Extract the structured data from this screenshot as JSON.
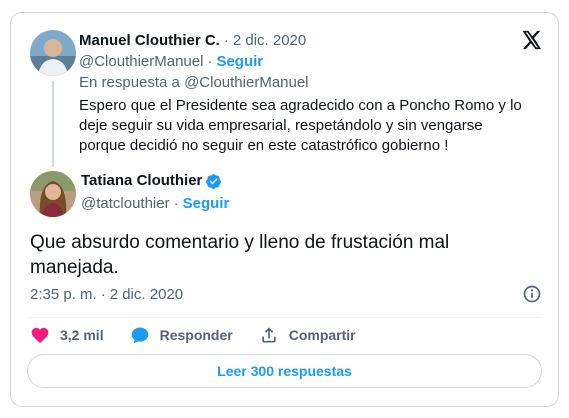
{
  "colors": {
    "accent": "#1d9bf0",
    "like": "#f91880",
    "muted": "#536471",
    "text": "#0f1419",
    "border": "#cfd9de"
  },
  "parent_tweet": {
    "author_name": "Manuel Clouthier C.",
    "separator": "·",
    "date": "2 dic. 2020",
    "handle": "@ClouthierManuel",
    "follow_label": "Seguir",
    "reply_to": "En respuesta a @ClouthierManuel",
    "text": "Espero que el Presidente sea agradecido con a Poncho Romo y lo deje seguir su vida empresarial, respetándolo y sin vengarse porque decidió no seguir en este catastrófico gobierno !"
  },
  "tweet": {
    "author_name": "Tatiana Clouthier",
    "verified_icon": "verified-badge-icon",
    "handle": "@tatclouthier",
    "separator": "·",
    "follow_label": "Seguir",
    "text": "Que absurdo comentario y lleno de frustación mal manejada.",
    "time": "2:35 p. m.",
    "date": "2 dic. 2020"
  },
  "actions": {
    "likes": "3,2 mil",
    "reply_label": "Responder",
    "share_label": "Compartir"
  },
  "read_replies_label": "Leer 300 respuestas",
  "icons": [
    "x-logo-icon",
    "info-icon",
    "heart-icon",
    "reply-bubble-icon",
    "share-icon",
    "verified-badge-icon"
  ]
}
